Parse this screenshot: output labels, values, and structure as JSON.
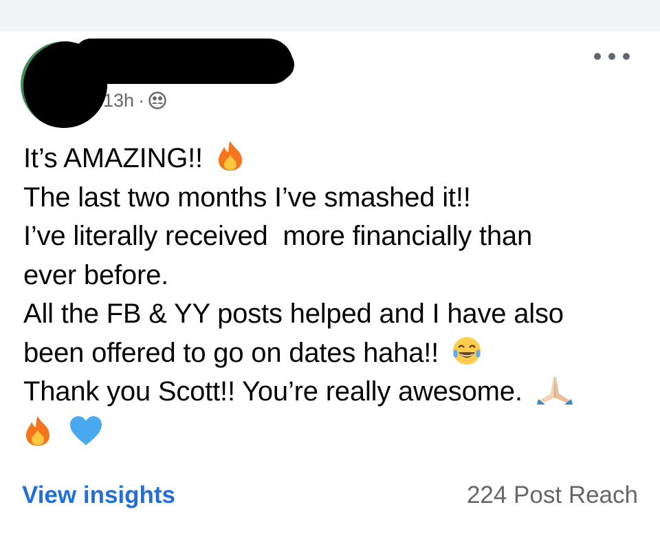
{
  "post": {
    "timestamp": "13h",
    "separator": "·",
    "audience_icon": "friends-icon",
    "more_icon": "more-options-icon",
    "lines": [
      "It’s AMAZING!!",
      "The last two months I’ve smashed it!!",
      "I’ve literally received  more financially than",
      "ever before.",
      "All the FB & YY posts helped and I have also",
      "been offered to go on dates haha!!",
      "Thank you Scott!! You’re really awesome."
    ],
    "emojis": [
      "fire-emoji",
      "tears-of-joy-emoji",
      "folded-hands-emoji",
      "fire-emoji",
      "blue-heart-emoji"
    ]
  },
  "footer": {
    "view_insights_label": "View insights",
    "post_reach": "224 Post Reach"
  },
  "colors": {
    "link_blue": "#216fdb",
    "meta_gray": "#65676b",
    "text": "#050505",
    "heart_blue": "#48a8f0",
    "fire_orange": "#f5741c"
  }
}
